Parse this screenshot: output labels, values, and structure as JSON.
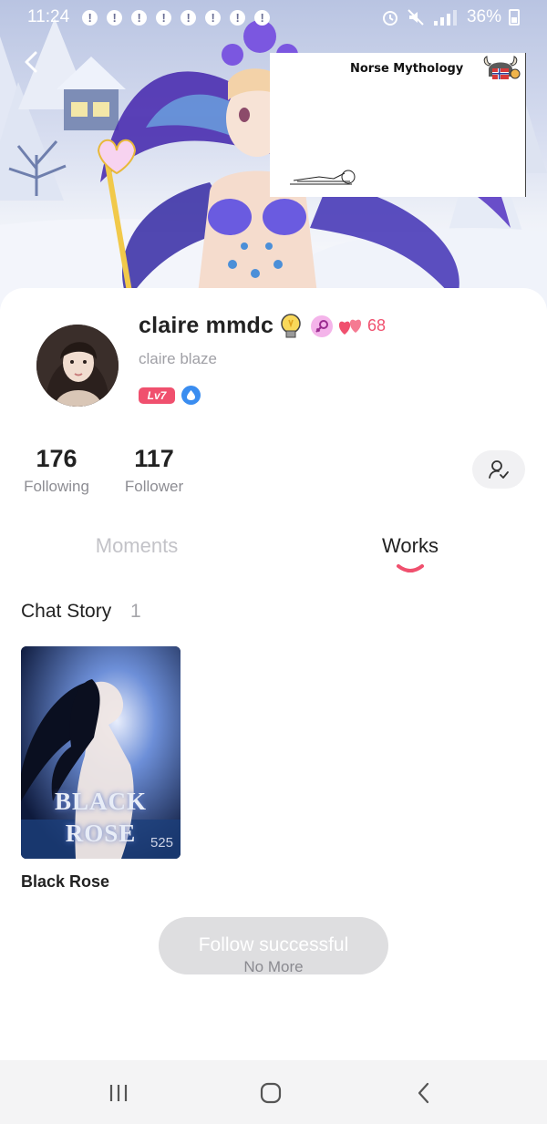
{
  "status_bar": {
    "time": "11:24",
    "battery": "36%"
  },
  "banner": {
    "sticker_title": "Norse Mythology"
  },
  "profile": {
    "username": "claire mmdc",
    "heart_count": "68",
    "nickname": "claire blaze",
    "level": "Lv7"
  },
  "stats": {
    "following": {
      "count": "176",
      "label": "Following"
    },
    "follower": {
      "count": "117",
      "label": "Follower"
    }
  },
  "tabs": [
    {
      "label": "Moments",
      "active": false
    },
    {
      "label": "Works",
      "active": true
    }
  ],
  "section": {
    "title": "Chat Story",
    "count": "1"
  },
  "stories": [
    {
      "cover_line1": "BLACK",
      "cover_line2": "ROSE",
      "views": "525",
      "title": "Black Rose"
    }
  ],
  "toast": {
    "message": "Follow successful",
    "footer": "No More"
  },
  "colors": {
    "accent": "#f0506e",
    "badge_blue": "#3a8df0",
    "badge_pink": "#f4b4ea"
  },
  "icons": {
    "back": "chevron-left-icon",
    "followed": "user-check-icon",
    "nav": [
      "recent-apps-icon",
      "home-icon",
      "back-icon"
    ]
  }
}
